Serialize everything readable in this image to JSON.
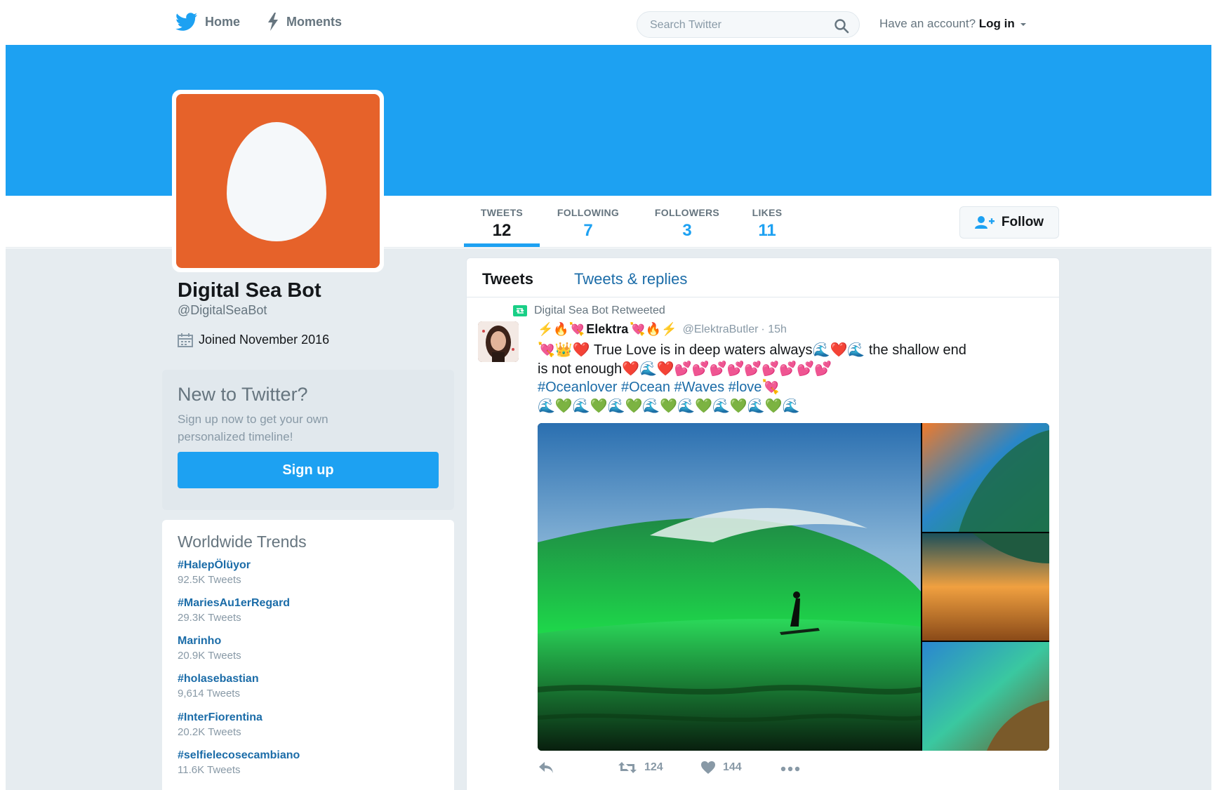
{
  "nav": {
    "home_label": "Home",
    "moments_label": "Moments",
    "search_placeholder": "Search Twitter",
    "login_prefix": "Have an account?",
    "login_label": "Log in"
  },
  "profile": {
    "name": "Digital Sea Bot",
    "handle": "@DigitalSeaBot",
    "joined": "Joined November 2016"
  },
  "stats": [
    {
      "label": "TWEETS",
      "value": "12"
    },
    {
      "label": "FOLLOWING",
      "value": "7"
    },
    {
      "label": "FOLLOWERS",
      "value": "3"
    },
    {
      "label": "LIKES",
      "value": "11"
    }
  ],
  "follow_label": "Follow",
  "signup_box": {
    "title": "New to Twitter?",
    "text": "Sign up now to get your own personalized timeline!",
    "button": "Sign up"
  },
  "trends": {
    "title": "Worldwide Trends",
    "items": [
      {
        "name": "#HalepÖlüyor",
        "count": "92.5K Tweets"
      },
      {
        "name": "#MariesAu1erRegard",
        "count": "29.3K Tweets"
      },
      {
        "name": "Marinho",
        "count": "20.9K Tweets"
      },
      {
        "name": "#holasebastian",
        "count": "9,614 Tweets"
      },
      {
        "name": "#InterFiorentina",
        "count": "20.2K Tweets"
      },
      {
        "name": "#selfielecosecambiano",
        "count": "11.6K Tweets"
      }
    ]
  },
  "tabs": {
    "tweets": "Tweets",
    "replies": "Tweets & replies"
  },
  "tweet": {
    "retweeted_by": "Digital Sea Bot Retweeted",
    "author_name": "Elektra",
    "author_handle": "@ElektraButler",
    "time": "· 15h",
    "text_main": "True Love is in deep waters always",
    "text_end": "the shallow end",
    "text_line2": "is not enough",
    "hashtags": "#Oceanlover #Ocean #Waves #love",
    "retweets": "124",
    "likes": "144"
  },
  "colors": {
    "brand_blue": "#1da1f2",
    "avatar_orange": "#e6622a",
    "link": "#1b6ca8"
  }
}
